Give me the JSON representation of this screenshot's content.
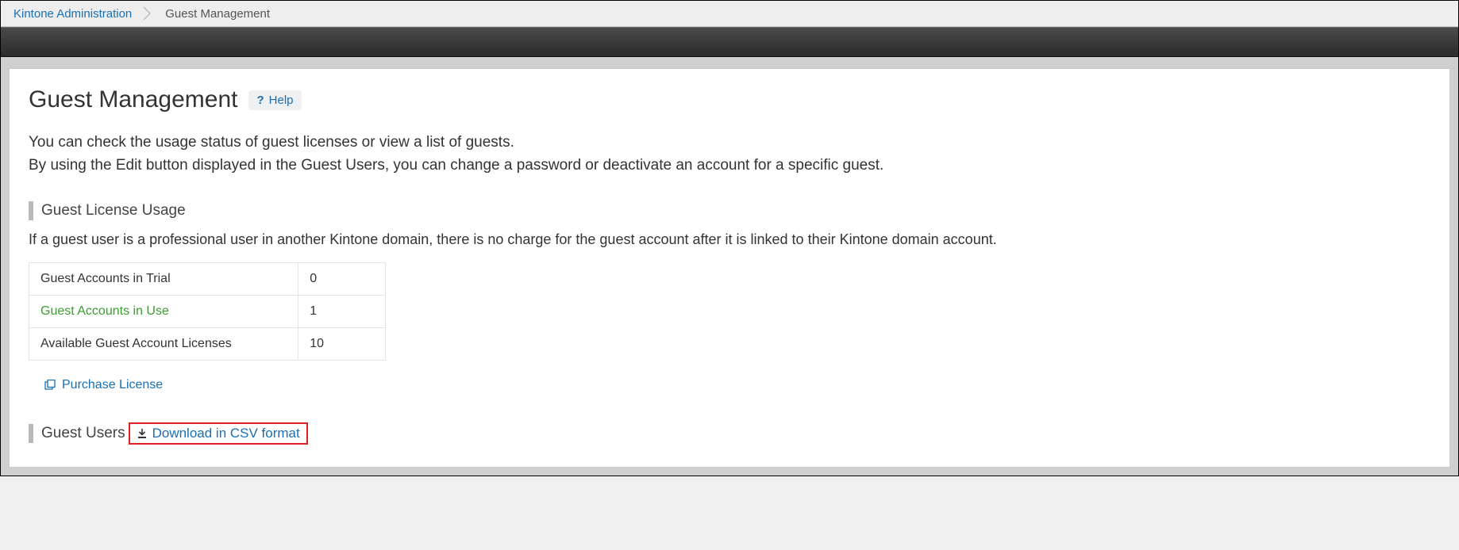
{
  "breadcrumb": {
    "root": "Kintone Administration",
    "current": "Guest Management"
  },
  "header": {
    "title": "Guest Management",
    "help_label": "Help"
  },
  "intro": {
    "line1": "You can check the usage status of guest licenses or view a list of guests.",
    "line2": "By using the Edit button displayed in the Guest Users, you can change a password or deactivate an account for a specific guest."
  },
  "license_section": {
    "heading": "Guest License Usage",
    "note": "If a guest user is a professional user in another Kintone domain, there is no charge for the guest account after it is linked to their Kintone domain account.",
    "rows": [
      {
        "label": "Guest Accounts in Trial",
        "value": "0",
        "link": false
      },
      {
        "label": "Guest Accounts in Use",
        "value": "1",
        "link": true
      },
      {
        "label": "Available Guest Account Licenses",
        "value": "10",
        "link": false
      }
    ],
    "purchase_label": "Purchase License"
  },
  "guest_users_section": {
    "heading": "Guest Users",
    "csv_label": "Download in CSV format"
  }
}
